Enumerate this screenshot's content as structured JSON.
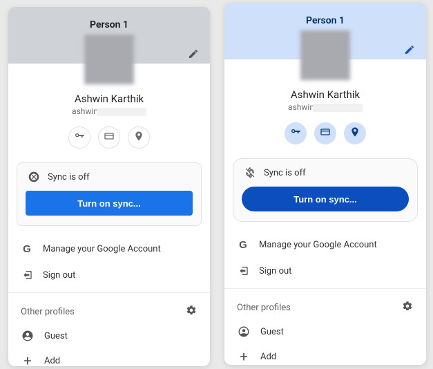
{
  "left": {
    "title": "Person 1",
    "name": "Ashwin Karthik",
    "email_prefix": "ashwin",
    "sync_status": "Sync is off",
    "sync_button": "Turn on sync...",
    "manage": "Manage your Google Account",
    "signout": "Sign out",
    "other_header": "Other profiles",
    "guest": "Guest",
    "add": "Add"
  },
  "right": {
    "title": "Person 1",
    "name": "Ashwin Karthik",
    "email_prefix": "ashwin",
    "sync_status": "Sync is off",
    "sync_button": "Turn on sync...",
    "manage": "Manage your Google Account",
    "signout": "Sign out",
    "other_header": "Other profiles",
    "guest": "Guest",
    "add": "Add"
  }
}
